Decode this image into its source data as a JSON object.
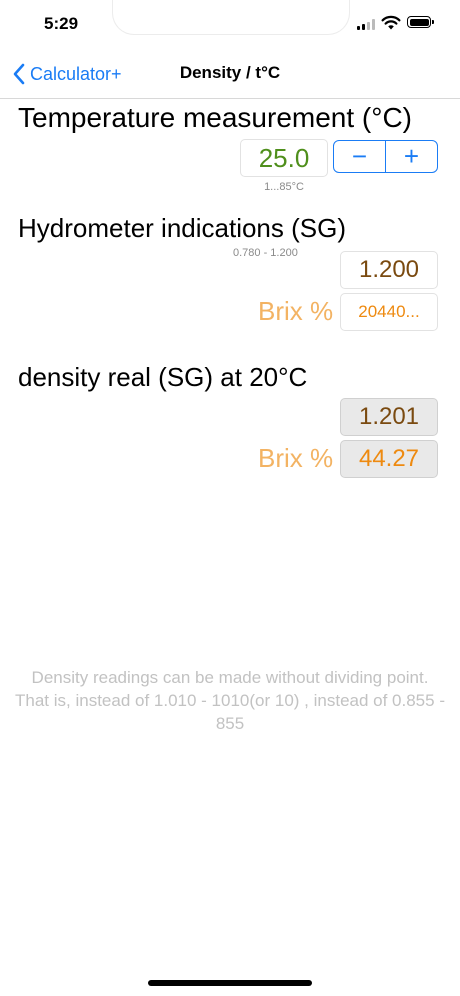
{
  "status_bar": {
    "time": "5:29"
  },
  "nav": {
    "back_label": "Calculator+",
    "title": "Density / t°C"
  },
  "temperature": {
    "heading": "Temperature measurement (°C)",
    "value": "25.0",
    "range_hint": "1...85°C",
    "minus_label": "−",
    "plus_label": "+"
  },
  "hydrometer": {
    "heading": "Hydrometer indications (SG)",
    "range_hint": "0.780 - 1.200",
    "sg_value": "1.200",
    "brix_label": "Brix %",
    "brix_value": "20440..."
  },
  "density_real": {
    "heading": "density real (SG) at 20°C",
    "sg_value": "1.201",
    "brix_label": "Brix %",
    "brix_value": "44.27"
  },
  "note": "Density readings can be made without dividing point. That is, instead of 1.010 - 1010(or 10) , instead of 0.855 -  855",
  "colors": {
    "accent": "#1a7cf5",
    "temperature_text": "#4f8f1c",
    "sg_text": "#7a4a10",
    "brix_value_text": "#ee8a10",
    "brix_label_text": "#f3b363"
  }
}
